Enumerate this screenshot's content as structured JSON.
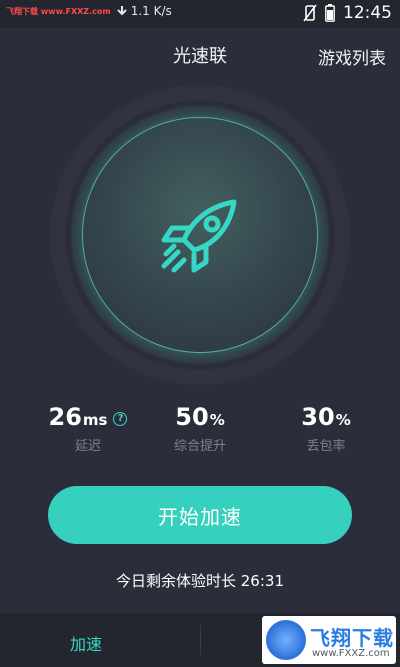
{
  "status_bar": {
    "watermark": "飞翔下载 www.FXXZ.com",
    "speed": "1.1 K/s",
    "time": "12:45",
    "icons": [
      "download-arrow-icon",
      "vibrate-off-icon",
      "battery-icon"
    ]
  },
  "header": {
    "title": "光速联",
    "game_list": "游戏列表"
  },
  "dial": {
    "icon": "rocket-icon",
    "accent": "#38d6c4"
  },
  "stats": {
    "latency": {
      "value": "26",
      "unit": "ms",
      "label": "延迟",
      "help": "?"
    },
    "boost": {
      "value": "50",
      "unit": "%",
      "label": "综合提升"
    },
    "loss": {
      "value": "30",
      "unit": "%",
      "label": "丢包率"
    }
  },
  "start_button": {
    "label": "开始加速",
    "color": "#35d0be"
  },
  "remaining": {
    "text": "今日剩余体验时长 26:31"
  },
  "tabbar": {
    "accelerate": "加速"
  },
  "watermark_logo": {
    "brand": "飞翔下载",
    "site": "www.FXXZ.com"
  }
}
